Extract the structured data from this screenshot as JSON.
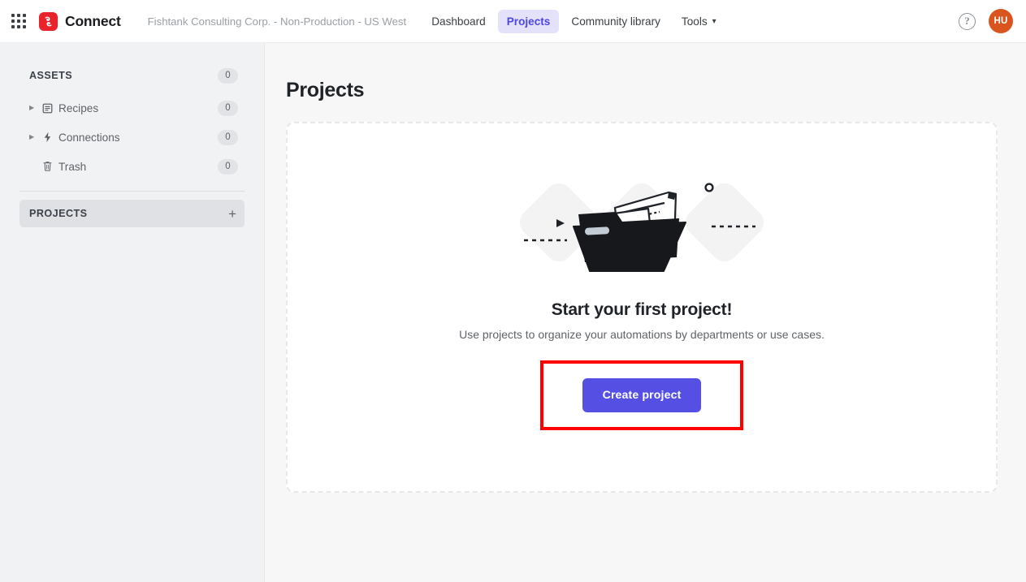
{
  "topbar": {
    "app_grid_icon": "apps-grid-icon",
    "brand_name": "Connect",
    "brand_icon": "connect-logo-icon",
    "workspace": "Fishtank Consulting Corp. - Non-Production - US West",
    "nav": [
      {
        "label": "Dashboard",
        "active": false,
        "has_caret": false
      },
      {
        "label": "Projects",
        "active": true,
        "has_caret": false
      },
      {
        "label": "Community library",
        "active": false,
        "has_caret": false
      },
      {
        "label": "Tools",
        "active": false,
        "has_caret": true
      }
    ],
    "caret_glyph": "⌄",
    "help_icon": "help-question-icon",
    "help_glyph": "?",
    "avatar_initials": "HU",
    "avatar_color": "#d9541e",
    "accent_color": "#5550e3",
    "brand_color": "#e8232a"
  },
  "sidebar": {
    "assets": {
      "label": "ASSETS",
      "count": "0"
    },
    "items": [
      {
        "label": "Recipes",
        "count": "0",
        "icon": "recipes-document-icon",
        "expandable": true
      },
      {
        "label": "Connections",
        "count": "0",
        "icon": "connections-bolt-icon",
        "expandable": true
      },
      {
        "label": "Trash",
        "count": "0",
        "icon": "trash-can-icon",
        "expandable": false
      }
    ],
    "projects": {
      "label": "PROJECTS",
      "add_glyph": "+"
    },
    "twisty_glyph": "▶"
  },
  "main": {
    "page_title": "Projects",
    "empty_state": {
      "illustration": "open-folder-with-documents-illustration",
      "title": "Start your first project!",
      "subtitle": "Use projects to organize your automations by departments or use cases.",
      "cta_label": "Create project",
      "highlight_color": "#ff0000"
    }
  }
}
